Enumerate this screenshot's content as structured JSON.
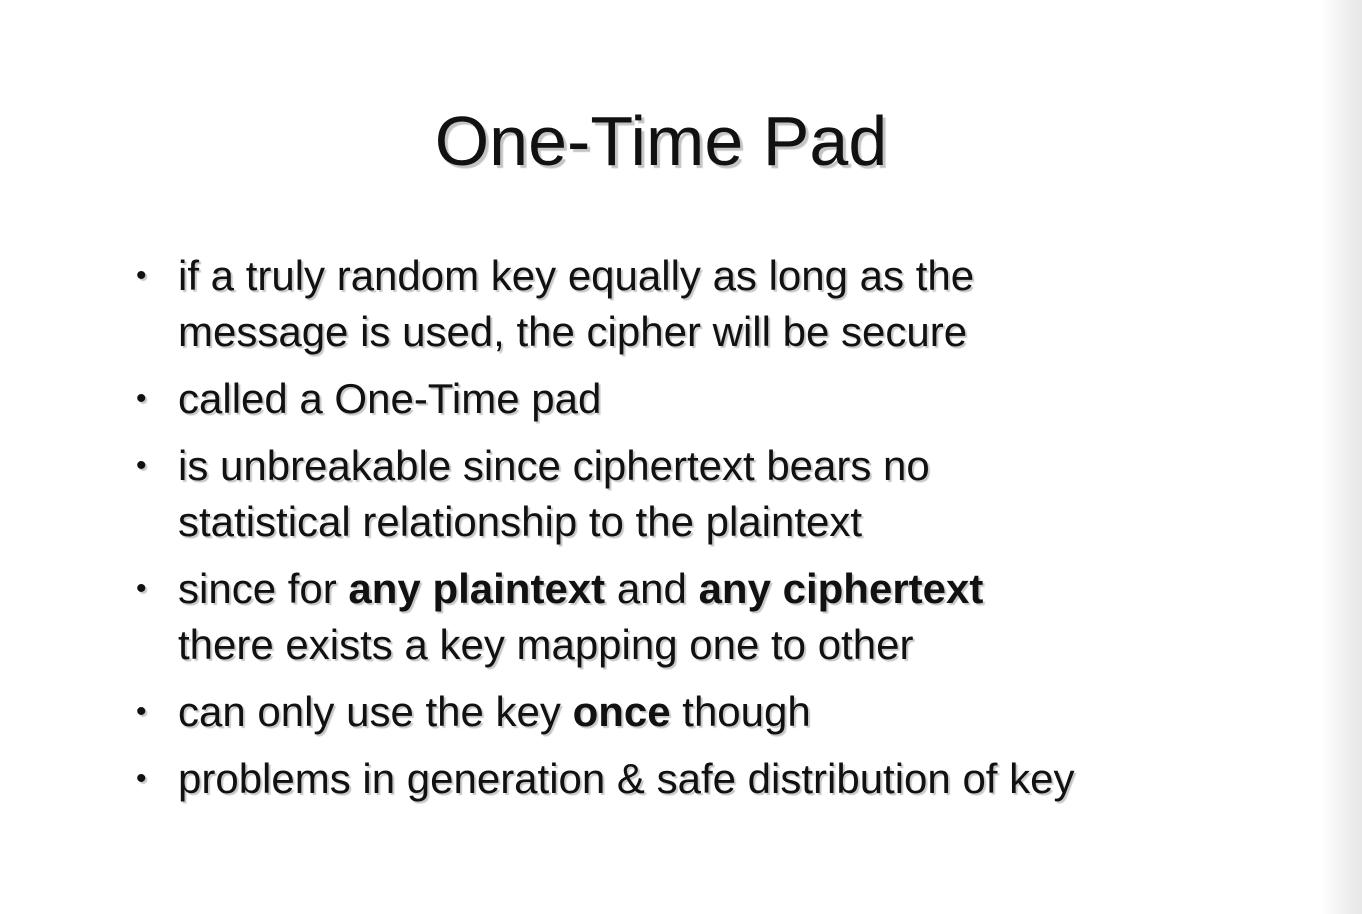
{
  "slide": {
    "title": "One-Time Pad",
    "bullet_glyph": "•",
    "bullets": [
      {
        "lines": [
          {
            "parts": [
              {
                "text": "if a truly random key equally as long as the",
                "bold": false
              }
            ]
          },
          {
            "parts": [
              {
                "text": "message is used, the cipher will be secure",
                "bold": false
              }
            ]
          }
        ]
      },
      {
        "lines": [
          {
            "parts": [
              {
                "text": "called a One-Time pad",
                "bold": false
              }
            ]
          }
        ]
      },
      {
        "lines": [
          {
            "parts": [
              {
                "text": "is unbreakable since ciphertext bears no",
                "bold": false
              }
            ]
          },
          {
            "parts": [
              {
                "text": "statistical relationship to the plaintext",
                "bold": false
              }
            ]
          }
        ]
      },
      {
        "lines": [
          {
            "parts": [
              {
                "text": "since for ",
                "bold": false
              },
              {
                "text": "any plaintext",
                "bold": true
              },
              {
                "text": " and ",
                "bold": false
              },
              {
                "text": "any ciphertext",
                "bold": true
              }
            ]
          },
          {
            "parts": [
              {
                "text": "there exists a key mapping one to other",
                "bold": false
              }
            ]
          }
        ]
      },
      {
        "lines": [
          {
            "parts": [
              {
                "text": "can only use the key ",
                "bold": false
              },
              {
                "text": "once",
                "bold": true
              },
              {
                "text": " though",
                "bold": false
              }
            ]
          }
        ]
      },
      {
        "lines": [
          {
            "parts": [
              {
                "text": "problems in generation & safe distribution of key",
                "bold": false
              }
            ]
          }
        ]
      }
    ]
  }
}
